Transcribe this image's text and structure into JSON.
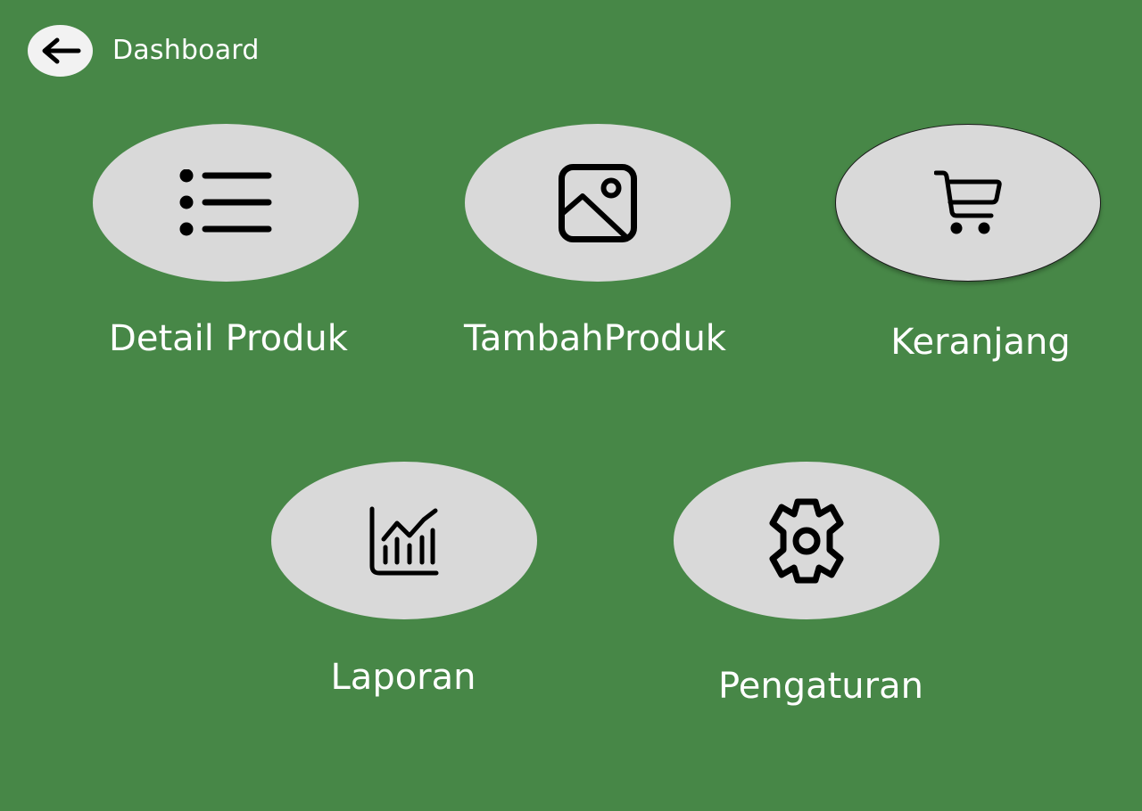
{
  "header": {
    "back_icon": "arrow-left-icon",
    "title": "Dashboard"
  },
  "menu": {
    "items": [
      {
        "id": "detail-produk",
        "label": "Detail Produk",
        "icon": "list-icon"
      },
      {
        "id": "tambah-produk",
        "label": "TambahProduk",
        "icon": "image-icon"
      },
      {
        "id": "keranjang",
        "label": "Keranjang",
        "icon": "shopping-cart-icon"
      },
      {
        "id": "laporan",
        "label": "Laporan",
        "icon": "chart-icon"
      },
      {
        "id": "pengaturan",
        "label": "Pengaturan",
        "icon": "gear-icon"
      }
    ]
  },
  "colors": {
    "background": "#478747",
    "tile": "#d9d9d9",
    "back_button": "#f2f2f2",
    "text": "#ffffff",
    "icon": "#000000"
  }
}
